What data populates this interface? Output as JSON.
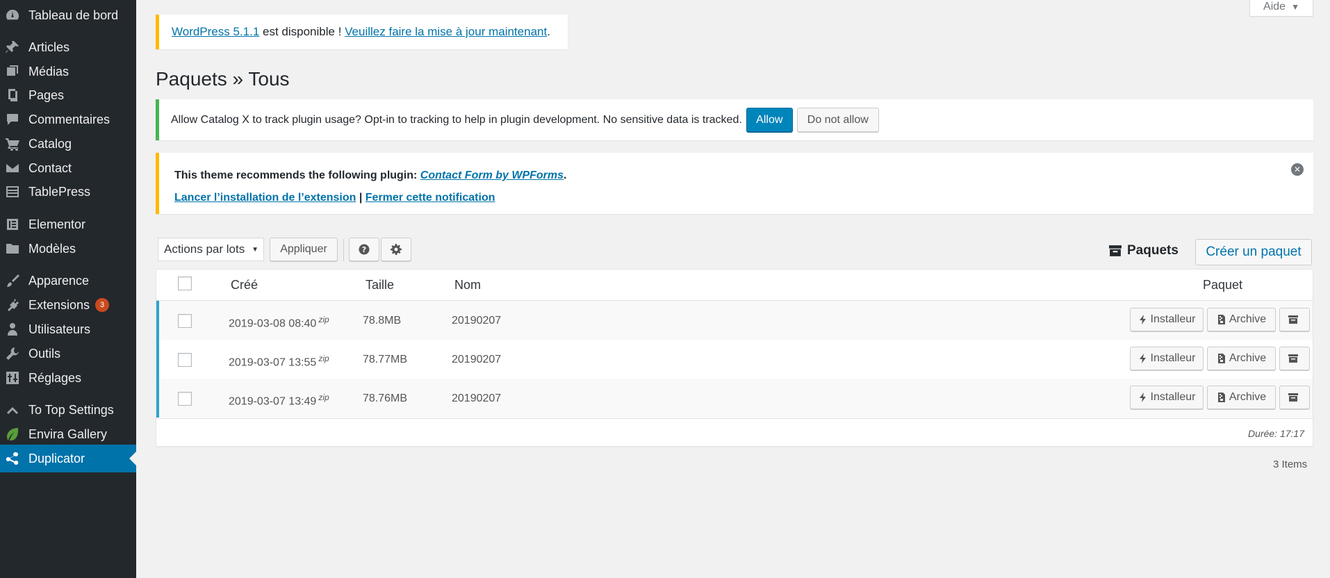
{
  "sidebar": {
    "items": [
      {
        "label": "Tableau de bord",
        "icon": "dashboard-icon"
      },
      {
        "label": "Articles",
        "icon": "pin-icon"
      },
      {
        "label": "Médias",
        "icon": "media-icon"
      },
      {
        "label": "Pages",
        "icon": "pages-icon"
      },
      {
        "label": "Commentaires",
        "icon": "comments-icon"
      },
      {
        "label": "Catalog",
        "icon": "cart-icon"
      },
      {
        "label": "Contact",
        "icon": "mail-icon"
      },
      {
        "label": "TablePress",
        "icon": "table-icon"
      },
      {
        "label": "Elementor",
        "icon": "elementor-icon"
      },
      {
        "label": "Modèles",
        "icon": "folder-icon"
      },
      {
        "label": "Apparence",
        "icon": "brush-icon"
      },
      {
        "label": "Extensions",
        "icon": "plugin-icon",
        "badge": "3"
      },
      {
        "label": "Utilisateurs",
        "icon": "users-icon"
      },
      {
        "label": "Outils",
        "icon": "wrench-icon"
      },
      {
        "label": "Réglages",
        "icon": "settings-icon"
      },
      {
        "label": "To Top Settings",
        "icon": "chevron-up-icon"
      },
      {
        "label": "Envira Gallery",
        "icon": "leaf-icon"
      },
      {
        "label": "Duplicator",
        "icon": "share-icon",
        "active": true
      }
    ]
  },
  "help_tab": {
    "label": "Aide"
  },
  "update_notice": {
    "link1": "WordPress 5.1.1",
    "text": " est disponible ! ",
    "link2": "Veuillez faire la mise à jour maintenant",
    "end": "."
  },
  "page_title": "Paquets » Tous",
  "tracking_notice": {
    "text": "Allow Catalog X to track plugin usage? Opt-in to tracking to help in plugin development. No sensitive data is tracked.",
    "allow": "Allow",
    "deny": "Do not allow"
  },
  "plugin_notice": {
    "text": "This theme recommends the following plugin: ",
    "plugin_link": "Contact Form by WPForms",
    "end": ".",
    "install_link": "Lancer l’installation de l’extension",
    "sep": " | ",
    "dismiss_link": "Fermer cette notification"
  },
  "toolbar": {
    "bulk_select": "Actions par lots",
    "apply": "Appliquer",
    "packages_label": "Paquets",
    "create": "Créer un paquet"
  },
  "table": {
    "headers": {
      "created": "Créé",
      "size": "Taille",
      "name": "Nom",
      "package": "Paquet"
    },
    "rows": [
      {
        "created": "2019-03-08 08:40",
        "type": "zip",
        "size": "78.8MB",
        "name": "20190207"
      },
      {
        "created": "2019-03-07 13:55",
        "type": "zip",
        "size": "78.77MB",
        "name": "20190207"
      },
      {
        "created": "2019-03-07 13:49",
        "type": "zip",
        "size": "78.76MB",
        "name": "20190207"
      }
    ],
    "row_buttons": {
      "installer": "Installeur",
      "archive": "Archive"
    },
    "footer": "Durée: 17:17"
  },
  "items_count": "3 Items",
  "colors": {
    "accent": "#0073aa",
    "sidebar": "#23282d",
    "row_accent": "#2ea2cc"
  }
}
